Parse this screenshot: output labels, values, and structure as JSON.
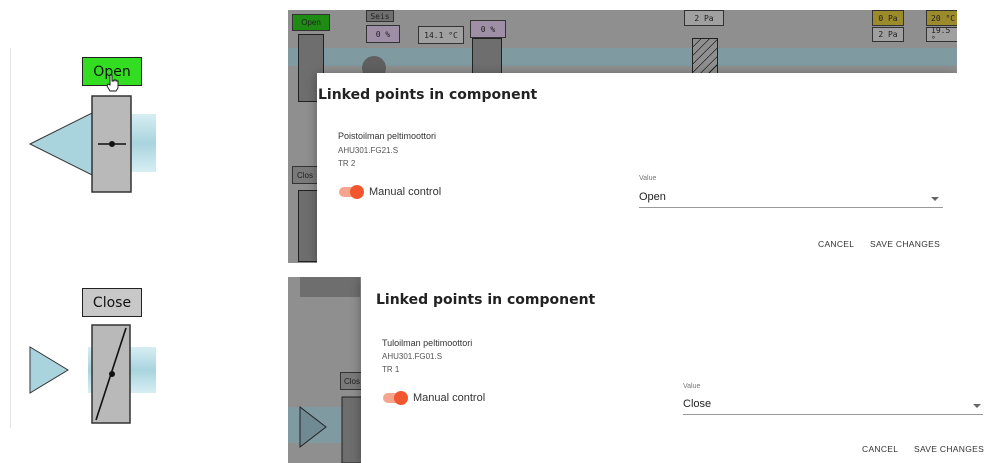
{
  "left_panel": {
    "open_button_label": "Open",
    "close_button_label": "Close"
  },
  "dialog_top": {
    "title": "Linked points in component",
    "component_name": "Poistoilman peltimoottori",
    "component_id": "AHU301.FG21.S",
    "component_tr": "TR 2",
    "manual_control_label": "Manual control",
    "manual_control_on": true,
    "value_label": "Value",
    "value": "Open",
    "cancel_label": "CANCEL",
    "save_label": "SAVE CHANGES",
    "background": {
      "open_label": "Open",
      "seis_label": "Seis",
      "fan_percent": "0 %",
      "temp_1": "14.1 °C",
      "percent_2": "0 %",
      "pressure_1": "2 Pa",
      "pressure_2": "0 Pa",
      "pressure_3": "2 Pa",
      "temp_2": "20 °C",
      "temp_3": "19.5 °",
      "clos_label": "Clos"
    }
  },
  "dialog_bottom": {
    "title": "Linked points in component",
    "component_name": "Tuloilman peltimoottori",
    "component_id": "AHU301.FG01.S",
    "component_tr": "TR 1",
    "manual_control_label": "Manual control",
    "manual_control_on": true,
    "value_label": "Value",
    "value": "Close",
    "cancel_label": "CANCEL",
    "save_label": "SAVE CHANGES",
    "background": {
      "clos_label": "Clos"
    }
  },
  "colors": {
    "open_green": "#33dd22",
    "close_gray": "#c8c8c8",
    "damper_gray": "#b9b9b9",
    "duct_blue": "#a9d4de",
    "toggle_orange": "#f0572e"
  }
}
